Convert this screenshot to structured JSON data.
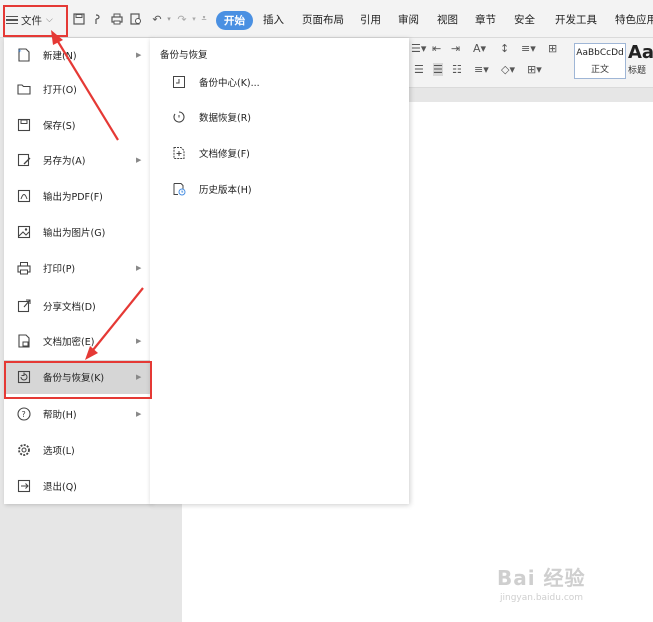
{
  "toolbar": {
    "file_label": "文件",
    "tabs": [
      "开始",
      "插入",
      "页面布局",
      "引用",
      "审阅",
      "视图",
      "章节",
      "安全",
      "开发工具",
      "特色应用"
    ]
  },
  "styles": {
    "normal_preview": "AaBbCcDd",
    "normal_label": "正文",
    "heading_preview": "Aa",
    "heading_label": "标题"
  },
  "file_menu": {
    "items": [
      {
        "label": "新建(N)",
        "icon": "new-doc-icon",
        "has_submenu": true
      },
      {
        "label": "打开(O)",
        "icon": "folder-icon",
        "has_submenu": false
      },
      {
        "label": "保存(S)",
        "icon": "save-icon",
        "has_submenu": false
      },
      {
        "label": "另存为(A)",
        "icon": "save-as-icon",
        "has_submenu": true
      },
      {
        "label": "输出为PDF(F)",
        "icon": "pdf-icon",
        "has_submenu": false
      },
      {
        "label": "输出为图片(G)",
        "icon": "image-icon",
        "has_submenu": false
      },
      {
        "label": "打印(P)",
        "icon": "print-icon",
        "has_submenu": true
      },
      {
        "label": "分享文档(D)",
        "icon": "share-icon",
        "has_submenu": false
      },
      {
        "label": "文档加密(E)",
        "icon": "encrypt-icon",
        "has_submenu": true
      },
      {
        "label": "备份与恢复(K)",
        "icon": "backup-icon",
        "has_submenu": true,
        "selected": true
      },
      {
        "label": "帮助(H)",
        "icon": "help-icon",
        "has_submenu": true
      },
      {
        "label": "选项(L)",
        "icon": "gear-icon",
        "has_submenu": false
      },
      {
        "label": "退出(Q)",
        "icon": "exit-icon",
        "has_submenu": false
      }
    ]
  },
  "submenu": {
    "title": "备份与恢复",
    "items": [
      {
        "label": "备份中心(K)...",
        "icon": "backup-center-icon"
      },
      {
        "label": "数据恢复(R)",
        "icon": "data-recovery-icon"
      },
      {
        "label": "文档修复(F)",
        "icon": "doc-repair-icon"
      },
      {
        "label": "历史版本(H)",
        "icon": "history-icon"
      }
    ]
  },
  "watermark": {
    "brand": "Bai 经验",
    "url": "jingyan.baidu.com"
  },
  "colors": {
    "accent": "#4a90e2",
    "annotation": "#e53935",
    "menu_hover": "#d6d6d6"
  }
}
